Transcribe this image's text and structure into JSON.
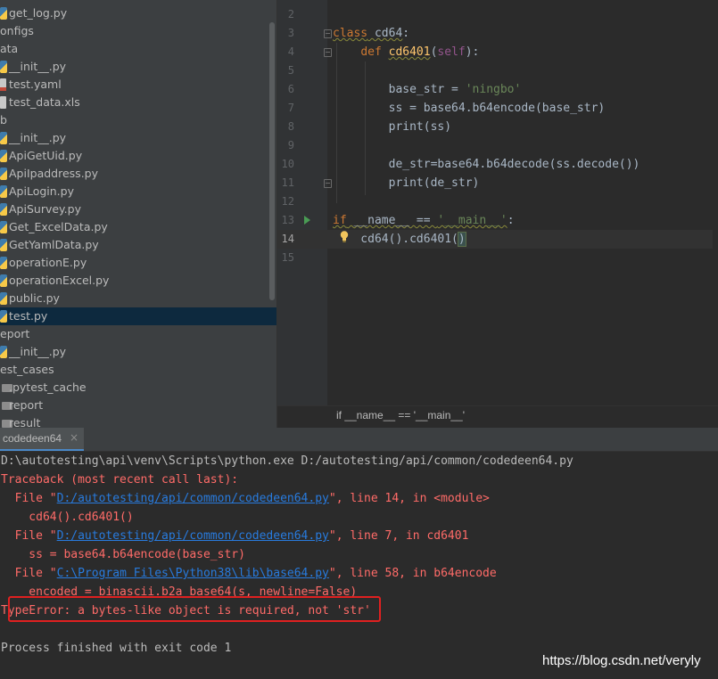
{
  "project_tree": {
    "items": [
      {
        "label": "get_log.py",
        "icon": "python-file-icon",
        "indent": 10
      },
      {
        "label": "onfigs",
        "icon": "",
        "indent": 0
      },
      {
        "label": "ata",
        "icon": "",
        "indent": 0
      },
      {
        "label": "__init__.py",
        "icon": "python-file-icon",
        "indent": 10
      },
      {
        "label": "test.yaml",
        "icon": "yaml-file-icon",
        "indent": 10
      },
      {
        "label": "test_data.xls",
        "icon": "excel-file-icon",
        "indent": 10
      },
      {
        "label": "b",
        "icon": "",
        "indent": 0
      },
      {
        "label": "__init__.py",
        "icon": "python-file-icon",
        "indent": 10
      },
      {
        "label": "ApiGetUid.py",
        "icon": "python-file-icon",
        "indent": 10
      },
      {
        "label": "ApiIpaddress.py",
        "icon": "python-file-icon",
        "indent": 10
      },
      {
        "label": "ApiLogin.py",
        "icon": "python-file-icon",
        "indent": 10
      },
      {
        "label": "ApiSurvey.py",
        "icon": "python-file-icon",
        "indent": 10
      },
      {
        "label": "Get_ExcelData.py",
        "icon": "python-file-icon",
        "indent": 10
      },
      {
        "label": "GetYamlData.py",
        "icon": "python-file-icon",
        "indent": 10
      },
      {
        "label": "operationE.py",
        "icon": "python-file-icon",
        "indent": 10
      },
      {
        "label": "operationExcel.py",
        "icon": "python-file-icon",
        "indent": 10
      },
      {
        "label": "public.py",
        "icon": "python-file-icon",
        "indent": 10
      },
      {
        "label": "test.py",
        "icon": "python-file-icon",
        "indent": 10,
        "selected": true
      },
      {
        "label": "eport",
        "icon": "",
        "indent": 0
      },
      {
        "label": "__init__.py",
        "icon": "python-file-icon",
        "indent": 10
      },
      {
        "label": "est_cases",
        "icon": "",
        "indent": 0
      },
      {
        "label": ".pytest_cache",
        "icon": "folder-icon",
        "indent": 10
      },
      {
        "label": "report",
        "icon": "folder-icon",
        "indent": 10
      },
      {
        "label": "result",
        "icon": "folder-icon",
        "indent": 10
      }
    ]
  },
  "editor": {
    "line_numbers": [
      "2",
      "3",
      "4",
      "5",
      "6",
      "7",
      "8",
      "9",
      "10",
      "11",
      "12",
      "13",
      "14",
      "15"
    ],
    "current_line": "14",
    "lines": {
      "l3": {
        "kw": "class",
        "name": " cd64",
        "rest": ":"
      },
      "l4": {
        "indent": "    ",
        "kw": "def",
        "sp": " ",
        "fn": "cd6401",
        "open": "(",
        "self": "self",
        "close": "):"
      },
      "l6": {
        "a": "        base_str = ",
        "s": "'ningbo'"
      },
      "l7": "        ss = base64.b64encode(base_str)",
      "l8": "        print(ss)",
      "l10": "        de_str=base64.b64decode(ss.decode())",
      "l11": "        print(de_str)",
      "l13": {
        "kw": "if",
        "a": " __name__ == ",
        "s": "'__main__'",
        "b": ":"
      },
      "l14": {
        "a": "    cd64().cd6401(",
        "b": ")"
      }
    },
    "breadcrumb": "if __name__ == '__main__'"
  },
  "run_panel": {
    "tab_label": "codedeen64",
    "tab_close": "×",
    "console": [
      {
        "cls": "c-norm",
        "parts": [
          {
            "t": "D:\\autotesting\\api\\venv\\Scripts\\python.exe D:/autotesting/api/common/codedeen64.py"
          }
        ]
      },
      {
        "cls": "c-err",
        "parts": [
          {
            "t": "Traceback (most recent call last):"
          }
        ]
      },
      {
        "cls": "c-err",
        "parts": [
          {
            "t": "  File \""
          },
          {
            "t": "D:/autotesting/api/common/codedeen64.py",
            "link": true
          },
          {
            "t": "\", line 14, in <module>"
          }
        ]
      },
      {
        "cls": "c-err",
        "parts": [
          {
            "t": "    cd64().cd6401()"
          }
        ]
      },
      {
        "cls": "c-err",
        "parts": [
          {
            "t": "  File \""
          },
          {
            "t": "D:/autotesting/api/common/codedeen64.py",
            "link": true
          },
          {
            "t": "\", line 7, in cd6401"
          }
        ]
      },
      {
        "cls": "c-err",
        "parts": [
          {
            "t": "    ss = base64.b64encode(base_str)"
          }
        ]
      },
      {
        "cls": "c-err",
        "parts": [
          {
            "t": "  File \""
          },
          {
            "t": "C:\\Program Files\\Python38\\lib\\base64.py",
            "link": true
          },
          {
            "t": "\", line 58, in b64encode"
          }
        ]
      },
      {
        "cls": "c-err",
        "parts": [
          {
            "t": "    encoded = binascii.b2a_base64(s, newline=False)"
          }
        ]
      },
      {
        "cls": "c-err",
        "parts": [
          {
            "t": "TypeError: a bytes-like object is required, not 'str'"
          }
        ]
      },
      {
        "cls": "c-norm",
        "parts": [
          {
            "t": ""
          }
        ]
      },
      {
        "cls": "c-norm",
        "parts": [
          {
            "t": "Process finished with exit code 1"
          }
        ]
      }
    ]
  },
  "watermark": "https://blog.csdn.net/veryly"
}
